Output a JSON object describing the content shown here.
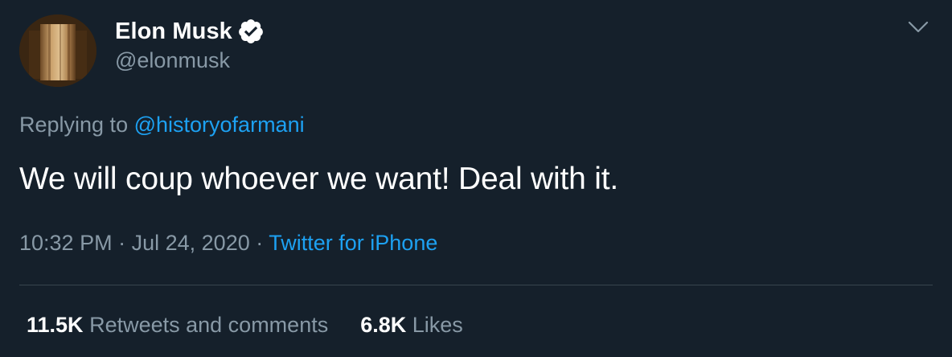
{
  "user": {
    "display_name": "Elon Musk",
    "handle": "@elonmusk",
    "verified": true
  },
  "reply": {
    "prefix": "Replying to",
    "mention": "@historyofarmani"
  },
  "tweet": {
    "text": "We will coup whoever we want! Deal with it."
  },
  "meta": {
    "time": "10:32 PM",
    "separator": "·",
    "date": "Jul 24, 2020",
    "source": "Twitter for iPhone"
  },
  "stats": {
    "retweets_count": "11.5K",
    "retweets_label": "Retweets and comments",
    "likes_count": "6.8K",
    "likes_label": "Likes"
  },
  "icons": {
    "verified": "verified-badge-icon",
    "caret": "chevron-down-icon"
  },
  "colors": {
    "background": "#15202b",
    "accent": "#1da1f2",
    "secondary_text": "#8899a6",
    "divider": "#38444d"
  }
}
